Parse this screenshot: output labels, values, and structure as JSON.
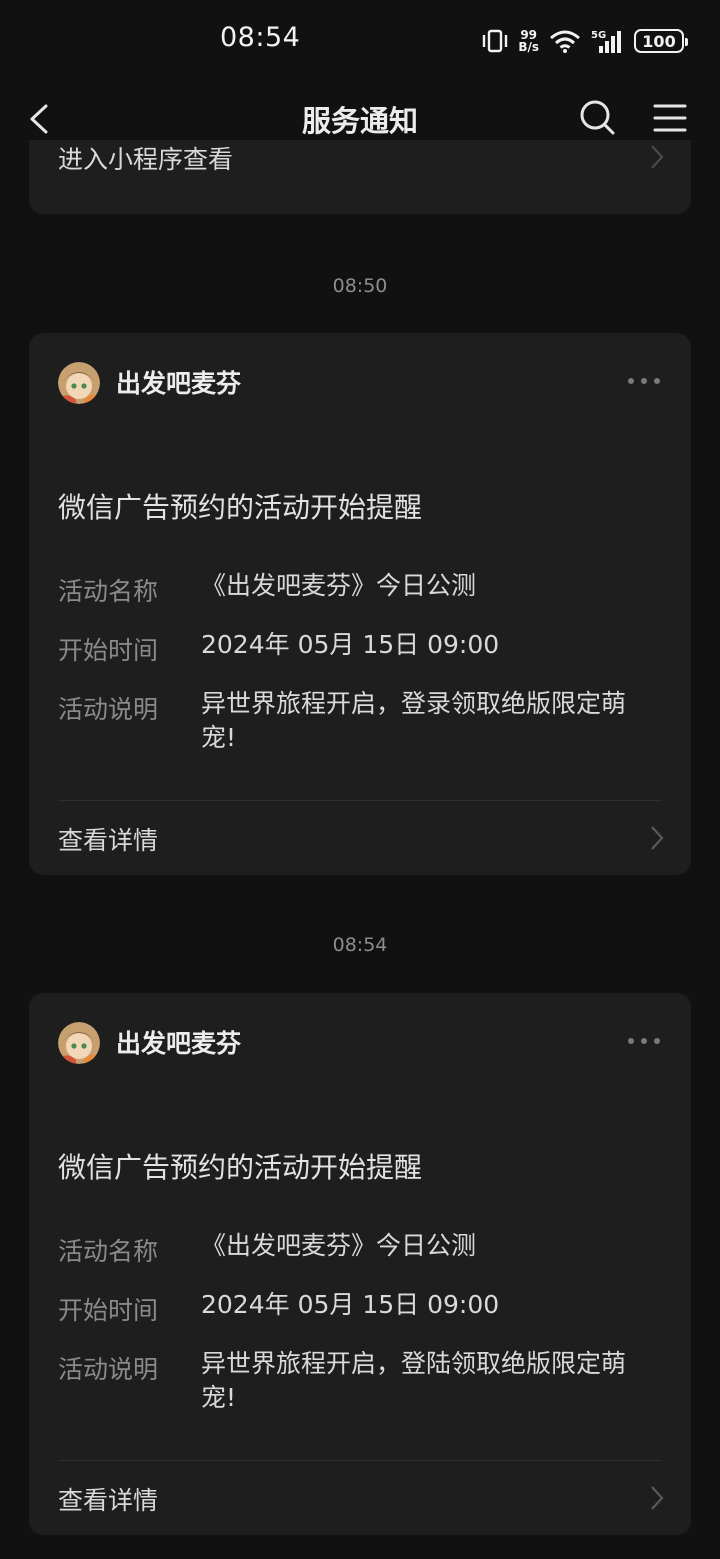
{
  "status_bar": {
    "time": "08:54",
    "speed_top": "99",
    "speed_bottom": "B/s",
    "network": "5G",
    "battery": "100"
  },
  "nav": {
    "title": "服务通知"
  },
  "partial_card": {
    "link_label": "进入小程序查看"
  },
  "messages": [
    {
      "timestamp": "08:50",
      "sender": "出发吧麦芬",
      "heading": "微信广告预约的活动开始提醒",
      "fields": [
        {
          "label": "活动名称",
          "value": "《出发吧麦芬》今日公测"
        },
        {
          "label": "开始时间",
          "value": "2024年 05月 15日 09:00"
        },
        {
          "label": "活动说明",
          "value_line1": "异世界旅程开启，登录领取绝版限定萌",
          "value_line2": "宠!"
        }
      ],
      "detail_label": "查看详情"
    },
    {
      "timestamp": "08:54",
      "sender": "出发吧麦芬",
      "heading": "微信广告预约的活动开始提醒",
      "fields": [
        {
          "label": "活动名称",
          "value": "《出发吧麦芬》今日公测"
        },
        {
          "label": "开始时间",
          "value": "2024年 05月 15日 09:00"
        },
        {
          "label": "活动说明",
          "value_line1": "异世界旅程开启，登陆领取绝版限定萌",
          "value_line2": "宠!"
        }
      ],
      "detail_label": "查看详情"
    }
  ],
  "colors": {
    "background": "#111111",
    "card": "#1e1e1e",
    "label_gray": "#8a8a8a",
    "text": "#d9d9d9"
  }
}
